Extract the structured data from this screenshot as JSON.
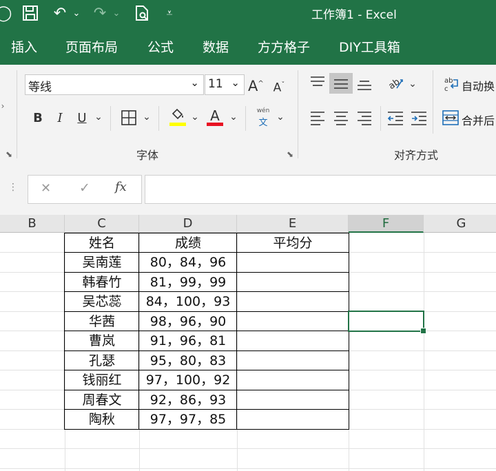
{
  "titlebar": {
    "title": "工作簿1  -  Excel",
    "bg": "#217346"
  },
  "menu": {
    "tabs": [
      "插入",
      "页面布局",
      "公式",
      "数据",
      "方方格子",
      "DIY工具箱"
    ]
  },
  "ribbon": {
    "font_name": "等线",
    "font_size": "11",
    "grow_font": "A",
    "shrink_font": "A",
    "bold": "B",
    "italic": "I",
    "underline": "U",
    "font_color_glyph": "A",
    "phonetic_top": "wén",
    "phonetic_bottom": "文",
    "font_group_label": "字体",
    "align_group_label": "对齐方式",
    "wrap_text": "自动换",
    "merge_center": "合并后",
    "font_color": "#e81123",
    "fill_color": "#ffff00"
  },
  "formula_bar": {
    "cancel": "✕",
    "enter": "✓",
    "fx": "fx",
    "value": ""
  },
  "sheet": {
    "columns": [
      "B",
      "C",
      "D",
      "E",
      "F",
      "G"
    ],
    "active_column": "F",
    "header": [
      "姓名",
      "成绩",
      "平均分"
    ],
    "rows": [
      {
        "name": "吴南莲",
        "scores": "80，84，96"
      },
      {
        "name": "韩春竹",
        "scores": "81，99，99"
      },
      {
        "name": "吴芯蕊",
        "scores": "84，100，93"
      },
      {
        "name": "华茜",
        "scores": "98，96，90"
      },
      {
        "name": "曹岚",
        "scores": "91，96，81"
      },
      {
        "name": "孔瑟",
        "scores": "95，80，83"
      },
      {
        "name": "钱丽红",
        "scores": "97，100，92"
      },
      {
        "name": "周春文",
        "scores": "92，86，93"
      },
      {
        "name": "陶秋",
        "scores": "97，97，85"
      }
    ]
  }
}
